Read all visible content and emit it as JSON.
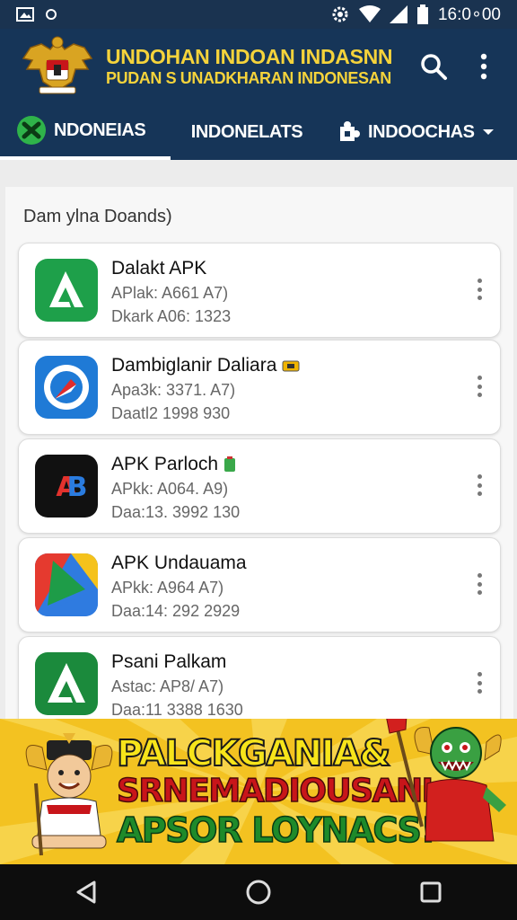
{
  "status": {
    "time": "16:0∘00",
    "icons": [
      "picture-icon",
      "sync-icon",
      "settings-icon",
      "wifi-icon",
      "signal-icon",
      "battery-icon"
    ]
  },
  "header": {
    "title": "UNDOHAN INDOAN INDASNN",
    "subtitle": "PUDAN S UNADKHARAN INDONESAN",
    "logo": "garuda-emblem"
  },
  "tabs": [
    {
      "label": "NDONEIAS",
      "icon": "green-x-icon",
      "active": true
    },
    {
      "label": "INDONELATS",
      "icon": "",
      "active": false
    },
    {
      "label": "INDOOCHAS",
      "icon": "puzzle-icon",
      "active": false
    }
  ],
  "section": {
    "title": "Dam ylna Doands)"
  },
  "apps": [
    {
      "name": "Dalakt APK",
      "meta1": "APlak: A661 A7)",
      "meta2": "Dkark A06: 1323",
      "icon": "green-triangle-app"
    },
    {
      "name": "Dambiglanir Daliara",
      "meta1": "Apa3k: 3371. A7)",
      "meta2": "Daatl2 1998 930",
      "icon": "blue-compass-app"
    },
    {
      "name": "APK Parloch",
      "meta1": "APkk: A064. A9)",
      "meta2": "Daa:13. 3992 130",
      "icon": "black-ab-app"
    },
    {
      "name": "APK Undauama",
      "meta1": "APkk: A964 A7)",
      "meta2": "Daa:14: 292 2929",
      "icon": "tri-color-app"
    },
    {
      "name": "Psani Palkam",
      "meta1": "Astac: AP8/ A7)",
      "meta2": "Daa:11 3388 1630",
      "icon": "green-a-app"
    }
  ],
  "banner": {
    "line1": "PALCKGANIA&",
    "line2": "SRNEMADIOUSANI",
    "line3": "APSOR LOYNACS!"
  },
  "nav": {
    "back": "back-icon",
    "home": "home-icon",
    "recents": "recents-icon"
  },
  "colors": {
    "header": "#163558",
    "accent_yellow": "#f5d33b",
    "banner": "#f3c221",
    "banner_red": "#c8151a",
    "banner_green": "#1e8a2a"
  }
}
